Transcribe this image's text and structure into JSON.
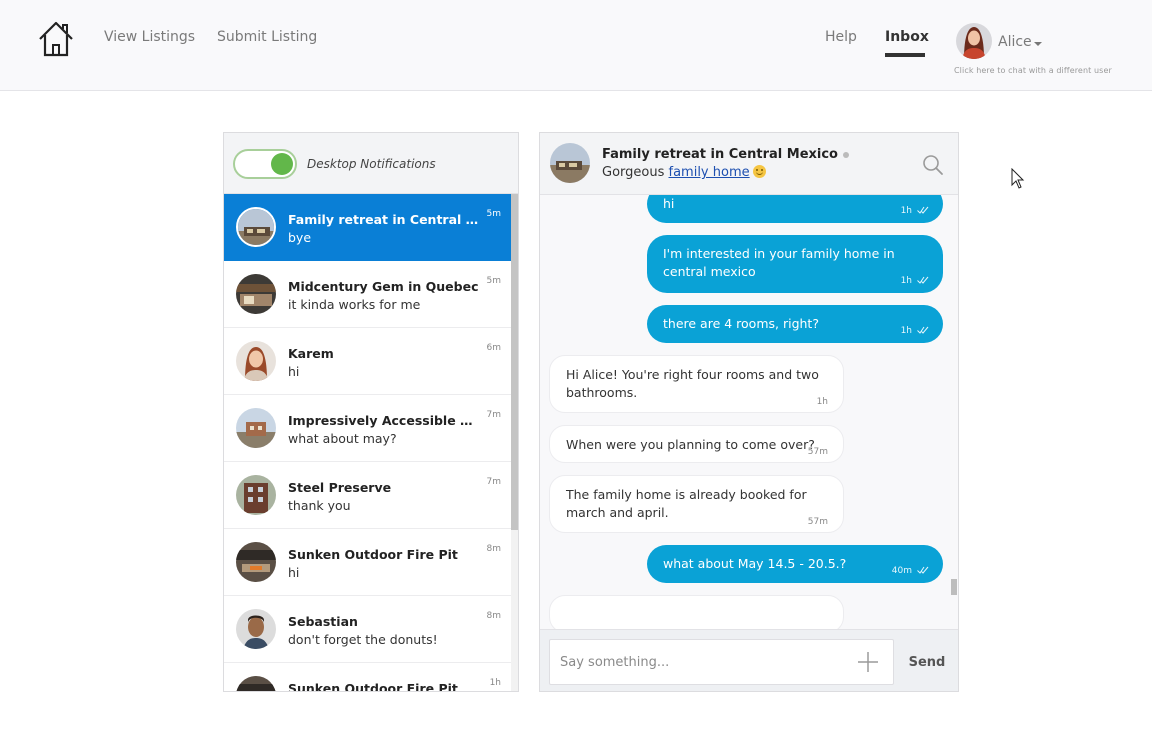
{
  "header": {
    "nav": {
      "view_listings": "View Listings",
      "submit_listing": "Submit Listing",
      "help": "Help",
      "inbox": "Inbox"
    },
    "user": {
      "name": "Alice",
      "hint": "Click here to chat with a different user"
    }
  },
  "notifications": {
    "label": "Desktop Notifications",
    "enabled": true
  },
  "conversations": [
    {
      "title": "Family retreat in Central Mexico",
      "preview": "bye",
      "time": "5m",
      "active": true
    },
    {
      "title": "Midcentury Gem in Quebec",
      "preview": "it kinda works for me",
      "time": "5m"
    },
    {
      "title": "Karem",
      "preview": "hi",
      "time": "6m"
    },
    {
      "title": "Impressively Accessible Home",
      "preview": "what about may?",
      "time": "7m"
    },
    {
      "title": "Steel Preserve",
      "preview": "thank you",
      "time": "7m"
    },
    {
      "title": "Sunken Outdoor Fire Pit",
      "preview": "hi",
      "time": "8m"
    },
    {
      "title": "Sebastian",
      "preview": "don't forget the donuts!",
      "time": "8m"
    },
    {
      "title": "Sunken Outdoor Fire Pit",
      "preview": "",
      "time": "1h"
    }
  ],
  "chat": {
    "title": "Family retreat in Central Mexico",
    "subtitle_prefix": "Gorgeous",
    "subtitle_link": "family home",
    "messages": [
      {
        "dir": "out",
        "lines": [
          "hi"
        ],
        "time": "1h"
      },
      {
        "dir": "out",
        "lines": [
          "I'm interested in your family home in",
          "central mexico"
        ],
        "time": "1h"
      },
      {
        "dir": "out",
        "lines": [
          "there are 4 rooms, right?"
        ],
        "time": "1h"
      },
      {
        "dir": "in",
        "lines": [
          "Hi Alice! You're right four rooms and two",
          "bathrooms."
        ],
        "time": "1h"
      },
      {
        "dir": "in",
        "lines": [
          "When were you planning to come over?"
        ],
        "time": "57m"
      },
      {
        "dir": "in",
        "lines": [
          "The family home is already booked for",
          "march and april."
        ],
        "time": "57m"
      },
      {
        "dir": "out",
        "lines": [
          "what about May 14.5 - 20.5.?"
        ],
        "time": "40m"
      }
    ],
    "composer": {
      "placeholder": "Say something...",
      "send_label": "Send"
    }
  },
  "colors": {
    "active_conversation": "#0a7fd6",
    "outgoing_bubble": "#0aa2d6",
    "toggle_on": "#62b74a"
  }
}
